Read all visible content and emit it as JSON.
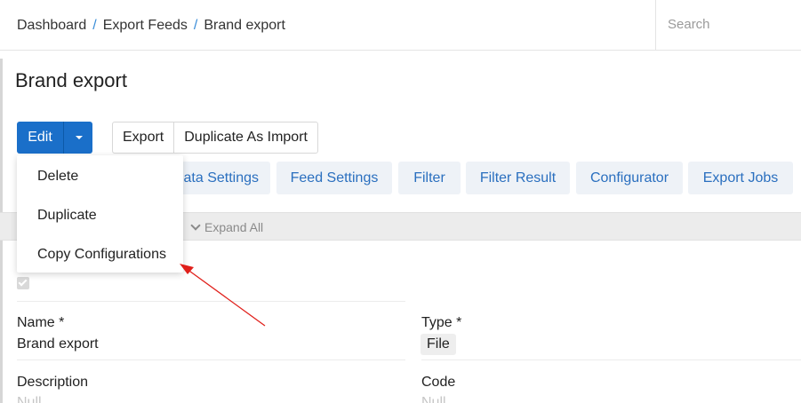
{
  "breadcrumb": {
    "items": [
      "Dashboard",
      "Export Feeds",
      "Brand export"
    ],
    "separator": "/"
  },
  "search": {
    "placeholder": "Search"
  },
  "page": {
    "title": "Brand export"
  },
  "actions": {
    "edit_label": "Edit",
    "export_label": "Export",
    "duplicate_as_import_label": "Duplicate As Import"
  },
  "dropdown": {
    "items": [
      "Delete",
      "Duplicate",
      "Copy Configurations"
    ]
  },
  "tabs": [
    "Data Settings",
    "Feed Settings",
    "Filter",
    "Filter Result",
    "Configurator",
    "Export Jobs"
  ],
  "expand_all_label": "Expand All",
  "fields": {
    "name_label": "Name *",
    "name_value": "Brand export",
    "type_label": "Type *",
    "type_value": "File",
    "description_label": "Description",
    "description_value": "Null",
    "code_label": "Code",
    "code_value": "Null"
  },
  "colors": {
    "primary": "#1a6fc9",
    "tab_text": "#2a6fbf",
    "tab_bg": "#eef2f7",
    "annotation_arrow": "#e0201b"
  },
  "icons": {
    "caret": "caret-down-icon",
    "expand": "chevron-down-icon",
    "checkbox": "checkmark-icon"
  }
}
